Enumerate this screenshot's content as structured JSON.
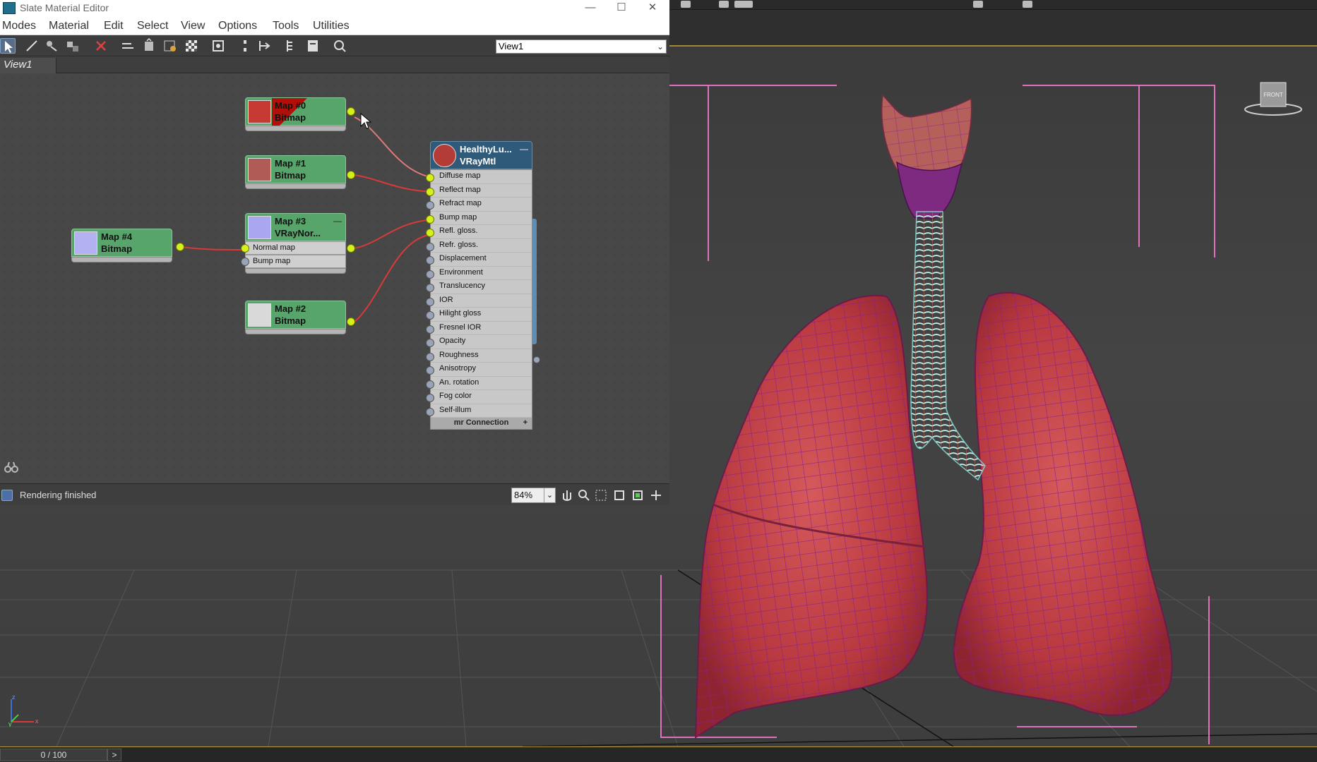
{
  "window": {
    "title": "Slate Material Editor",
    "minimize_glyph": "—",
    "maximize_glyph": "☐",
    "close_glyph": "✕"
  },
  "menu": [
    "Modes",
    "Material",
    "Edit",
    "Select",
    "View",
    "Options",
    "Tools",
    "Utilities"
  ],
  "toolbar": {
    "icons": [
      "select-arrow-icon",
      "pick-material-icon",
      "put-to-scene-icon",
      "assign-to-selection-icon",
      "delete-icon",
      "move-children-icon",
      "hide-unused-slots-icon",
      "show-background-icon",
      "checker-background-icon",
      "preview-icon",
      "layout-all-icon",
      "layout-children-icon",
      "material-map-navigator-icon",
      "parameter-editor-icon",
      "render-icon"
    ],
    "view_select": {
      "value": "View1",
      "chevron": "⌄"
    }
  },
  "view_tab": {
    "label": "View1"
  },
  "nodes": {
    "map0": {
      "name": "Map #0",
      "type": "Bitmap",
      "thumb_color": "#c73a34"
    },
    "map1": {
      "name": "Map #1",
      "type": "Bitmap",
      "thumb_color": "#b15b57"
    },
    "map2": {
      "name": "Map #2",
      "type": "Bitmap",
      "thumb_color": "#d9d9d9"
    },
    "map3": {
      "name": "Map #3",
      "type": "VRayNor...",
      "thumb_color": "#a9a7ef",
      "slots": [
        "Normal map",
        "Bump map"
      ],
      "minimize": "—"
    },
    "map4": {
      "name": "Map #4",
      "type": "Bitmap",
      "thumb_color": "#b4b1f0"
    },
    "material": {
      "name": "HealthyLu...",
      "type": "VRayMtl",
      "thumb_color": "#b33c36",
      "minimize": "—",
      "slots": [
        "Diffuse map",
        "Reflect map",
        "Refract map",
        "Bump map",
        "Refl. gloss.",
        "Refr. gloss.",
        "Displacement",
        "Environment",
        "Translucency",
        "IOR",
        "Hilight gloss",
        "Fresnel IOR",
        "Opacity",
        "Roughness",
        "Anisotropy",
        "An. rotation",
        "Fog color",
        "Self-illum"
      ],
      "connected_slots": [
        "Diffuse map",
        "Reflect map",
        "Bump map",
        "Refl. gloss."
      ],
      "footer": "mr Connection",
      "footer_plus": "+"
    }
  },
  "status": {
    "text": "Rendering finished",
    "zoom": "84%",
    "zoom_chevron": "⌄"
  },
  "nav_icons": [
    "pan-icon",
    "zoom-icon",
    "zoom-region-icon",
    "zoom-extents-icon",
    "zoom-extents-selected-icon",
    "pan-to-selected-icon"
  ],
  "viewport": {
    "viewcube_label": "FRONT",
    "axis": {
      "x": "x",
      "y": "y",
      "z": "z"
    },
    "time": {
      "value": "0 / 100",
      "next": ">"
    },
    "colors": {
      "lung": "#c2494c",
      "wire": "#8a1f8f",
      "trachea": "#9fe0dc",
      "bbox": "#e070c0",
      "accent": "#b49c3c"
    }
  }
}
